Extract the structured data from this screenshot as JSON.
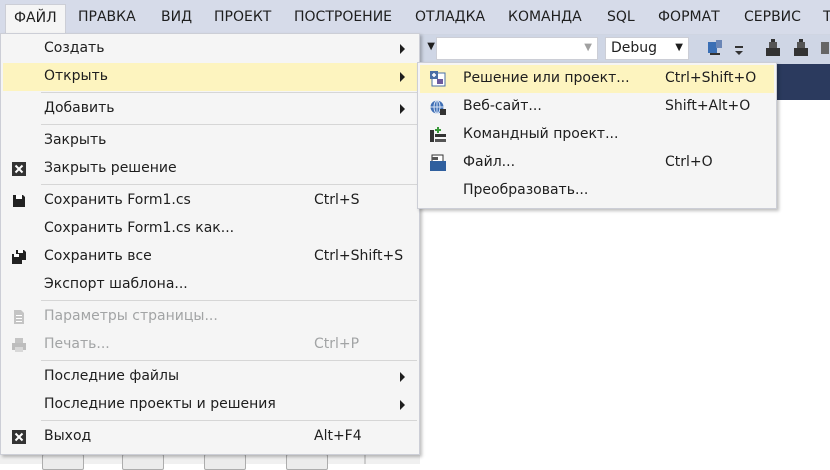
{
  "menubar": {
    "items": [
      "ФАЙЛ",
      "ПРАВКА",
      "ВИД",
      "ПРОЕКТ",
      "ПОСТРОЕНИЕ",
      "ОТЛАДКА",
      "КОМАНДА",
      "SQL",
      "ФОРМАТ",
      "СЕРВИС",
      "Т"
    ],
    "active": "ФАЙЛ"
  },
  "toolbar": {
    "config_value": "Debug",
    "platform_value": ""
  },
  "file_menu": {
    "items": [
      {
        "label": "Создать",
        "shortcut": "",
        "submenu": true,
        "icon": "",
        "state": "normal"
      },
      {
        "label": "Открыть",
        "shortcut": "",
        "submenu": true,
        "icon": "",
        "state": "highlighted"
      },
      {
        "label": "Добавить",
        "shortcut": "",
        "submenu": true,
        "icon": "",
        "state": "normal"
      },
      {
        "label": "Закрыть",
        "shortcut": "",
        "submenu": false,
        "icon": "",
        "state": "normal"
      },
      {
        "label": "Закрыть решение",
        "shortcut": "",
        "submenu": false,
        "icon": "close-solution-icon",
        "state": "normal"
      },
      {
        "label": "Сохранить Form1.cs",
        "shortcut": "Ctrl+S",
        "submenu": false,
        "icon": "save-icon",
        "state": "normal"
      },
      {
        "label": "Сохранить Form1.cs как...",
        "shortcut": "",
        "submenu": false,
        "icon": "",
        "state": "normal"
      },
      {
        "label": "Сохранить все",
        "shortcut": "Ctrl+Shift+S",
        "submenu": false,
        "icon": "save-all-icon",
        "state": "normal"
      },
      {
        "label": "Экспорт шаблона...",
        "shortcut": "",
        "submenu": false,
        "icon": "",
        "state": "normal"
      },
      {
        "label": "Параметры страницы...",
        "shortcut": "",
        "submenu": false,
        "icon": "page-setup-icon",
        "state": "disabled"
      },
      {
        "label": "Печать...",
        "shortcut": "Ctrl+P",
        "submenu": false,
        "icon": "print-icon",
        "state": "disabled"
      },
      {
        "label": "Последние файлы",
        "shortcut": "",
        "submenu": true,
        "icon": "",
        "state": "normal"
      },
      {
        "label": "Последние проекты и решения",
        "shortcut": "",
        "submenu": true,
        "icon": "",
        "state": "normal"
      },
      {
        "label": "Выход",
        "shortcut": "Alt+F4",
        "submenu": false,
        "icon": "exit-icon",
        "state": "normal"
      }
    ]
  },
  "open_submenu": {
    "items": [
      {
        "label": "Решение или проект...",
        "shortcut": "Ctrl+Shift+O",
        "icon": "open-solution-icon",
        "state": "highlighted"
      },
      {
        "label": "Веб-сайт...",
        "shortcut": "Shift+Alt+O",
        "icon": "website-icon",
        "state": "normal"
      },
      {
        "label": "Командный проект...",
        "shortcut": "",
        "icon": "team-project-icon",
        "state": "normal"
      },
      {
        "label": "Файл...",
        "shortcut": "Ctrl+O",
        "icon": "open-file-icon",
        "state": "normal"
      },
      {
        "label": "Преобразовать...",
        "shortcut": "",
        "icon": "",
        "state": "normal"
      }
    ]
  },
  "colors": {
    "menubar_bg": "#d6dbe9",
    "menu_bg": "#f5f5f5",
    "highlight": "#fdf4bf",
    "disabled_text": "#a2a4a5"
  }
}
